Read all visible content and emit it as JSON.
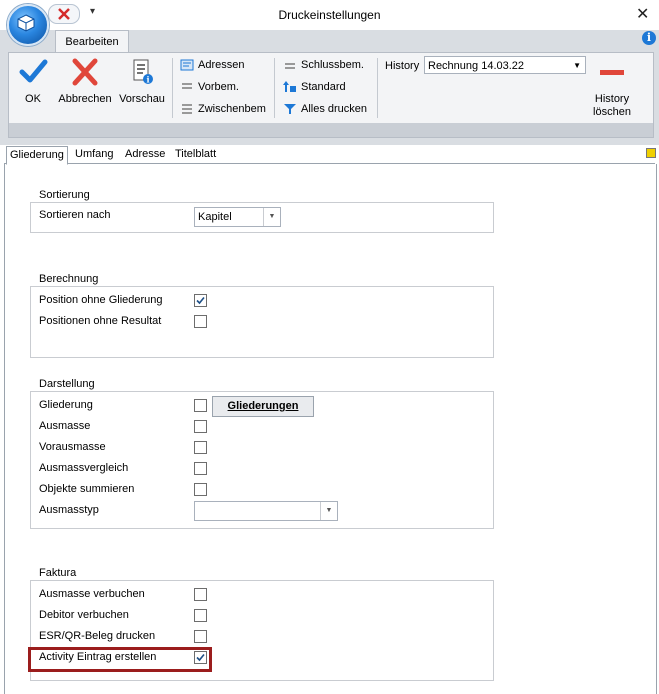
{
  "window": {
    "title": "Druckeinstellungen"
  },
  "ribbon": {
    "tab": "Bearbeiten",
    "ok": "OK",
    "abbrechen": "Abbrechen",
    "vorschau": "Vorschau",
    "adressen": "Adressen",
    "vorbem": "Vorbem.",
    "zwischenbem": "Zwischenbem",
    "schlussbem": "Schlussbem.",
    "standard": "Standard",
    "alles_drucken": "Alles drucken",
    "history_label": "History",
    "history_value": "Rechnung 14.03.22",
    "history_loeschen_1": "History",
    "history_loeschen_2": "löschen"
  },
  "tabs": [
    "Gliederung",
    "Umfang",
    "Adresse",
    "Titelblatt"
  ],
  "sortierung": {
    "title": "Sortierung",
    "label": "Sortieren nach",
    "value": "Kapitel"
  },
  "berechnung": {
    "title": "Berechnung",
    "items": [
      {
        "label": "Position ohne Gliederung",
        "checked": true
      },
      {
        "label": "Positionen ohne Resultat",
        "checked": false
      }
    ]
  },
  "darstellung": {
    "title": "Darstellung",
    "items": [
      {
        "label": "Gliederung",
        "checked": false
      },
      {
        "label": "Ausmasse",
        "checked": false
      },
      {
        "label": "Vorausmasse",
        "checked": false
      },
      {
        "label": "Ausmassvergleich",
        "checked": false
      },
      {
        "label": "Objekte summieren",
        "checked": false
      }
    ],
    "button": "Gliederungen",
    "ausmasstyp_label": "Ausmasstyp",
    "ausmasstyp_value": ""
  },
  "faktura": {
    "title": "Faktura",
    "items": [
      {
        "label": "Ausmasse verbuchen",
        "checked": false
      },
      {
        "label": "Debitor verbuchen",
        "checked": false
      },
      {
        "label": "ESR/QR-Beleg drucken",
        "checked": false
      },
      {
        "label": "Activity Eintrag erstellen",
        "checked": true
      }
    ]
  },
  "colors": {
    "highlight": "#9b1d1d",
    "accent": "#1d78d6",
    "delete": "#e0463a"
  }
}
